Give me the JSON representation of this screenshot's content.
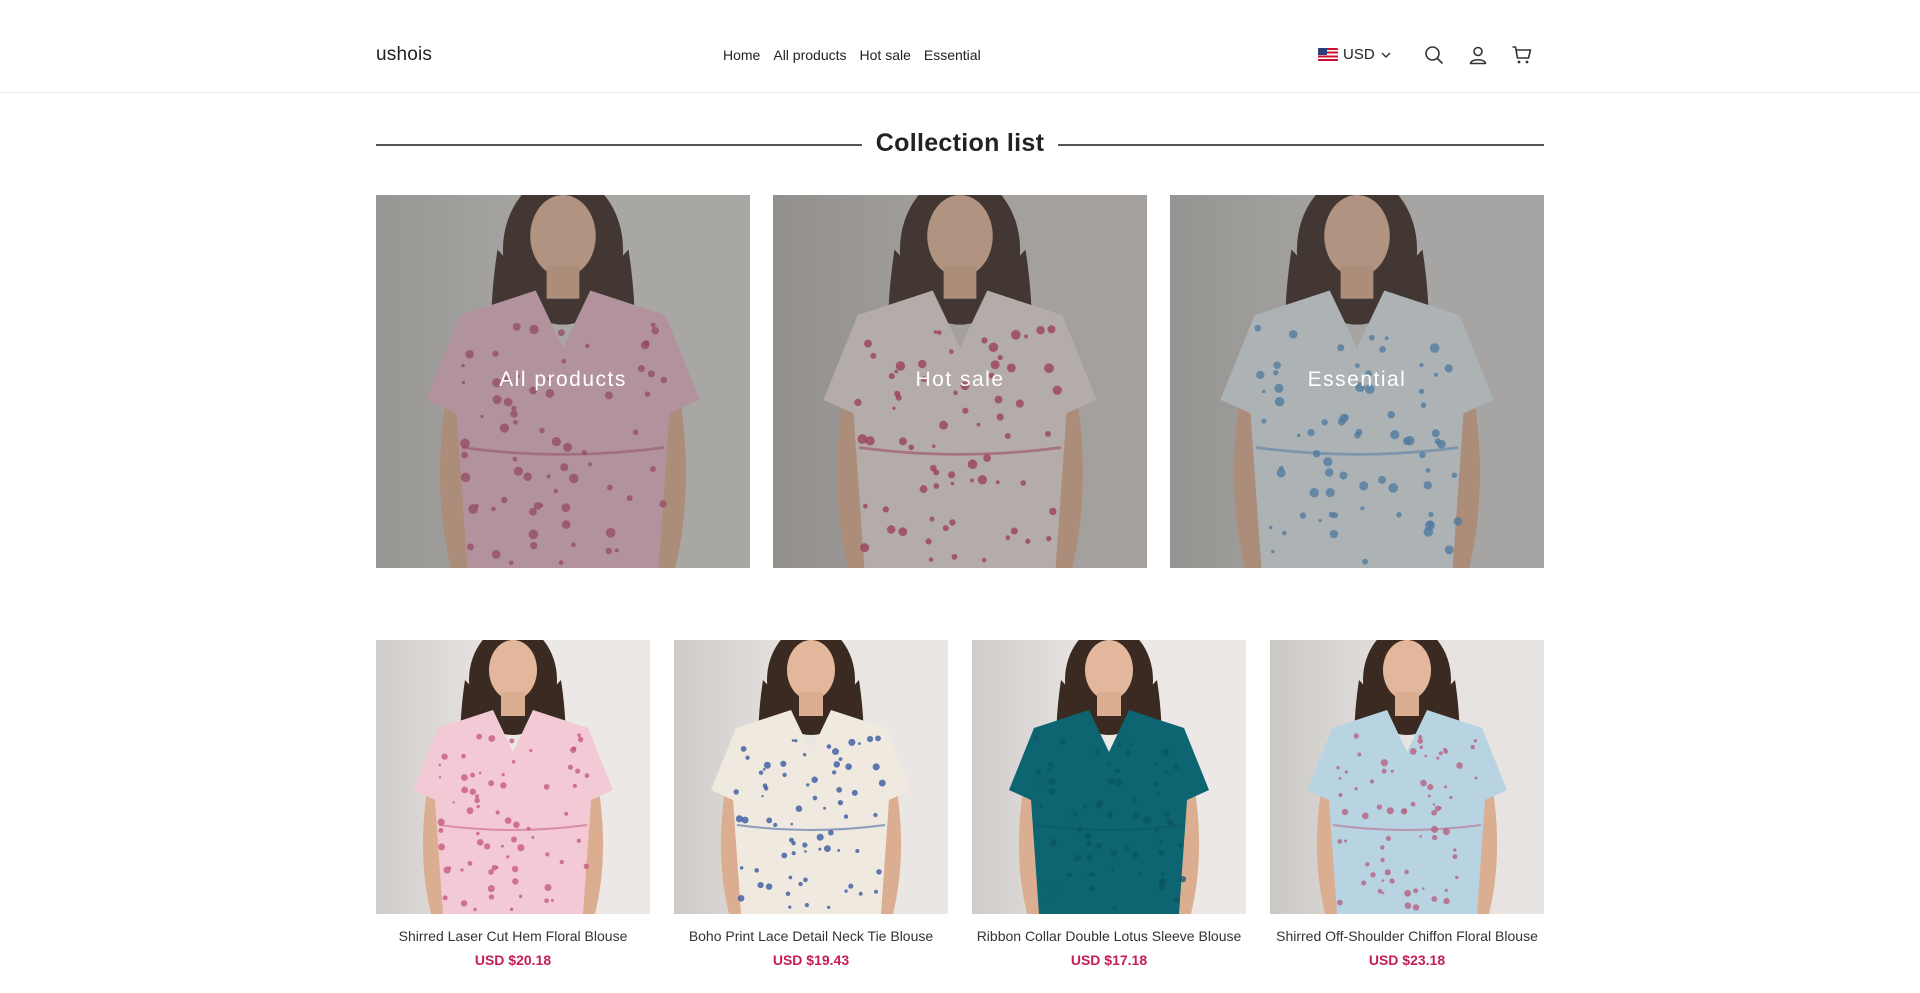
{
  "header": {
    "logo": "ushois",
    "nav": [
      "Home",
      "All products",
      "Hot sale",
      "Essential"
    ],
    "currency": "USD",
    "icons": [
      "flag-us-icon",
      "chevron-down-icon",
      "search-icon",
      "account-icon",
      "cart-icon"
    ]
  },
  "collection": {
    "title": "Collection list",
    "cards": [
      {
        "label": "All products",
        "palette": {
          "bg": "#d9d6d2",
          "dress": "#e7b7c6",
          "dot": "#b8456e"
        }
      },
      {
        "label": "Hot sale",
        "palette": {
          "bg": "#cfcbc7",
          "dress": "#e9ddd8",
          "dot": "#c12f5a"
        }
      },
      {
        "label": "Essential",
        "palette": {
          "bg": "#d6d3cf",
          "dress": "#dfe6ec",
          "dot": "#4a8fc9"
        }
      }
    ]
  },
  "products": [
    {
      "name": "Shirred Laser Cut Hem Floral Blouse",
      "price": "USD $20.18",
      "palette": {
        "bg": "#ece8e6",
        "dress": "#f2c9d5",
        "dot": "#c2537b"
      }
    },
    {
      "name": "Boho Print Lace Detail Neck Tie Blouse",
      "price": "USD $19.43",
      "palette": {
        "bg": "#e9e6e3",
        "dress": "#efe9df",
        "dot": "#2c4f9c"
      }
    },
    {
      "name": "Ribbon Collar Double Lotus Sleeve Blouse",
      "price": "USD $17.18",
      "palette": {
        "bg": "#ebe8e6",
        "dress": "#0d6572",
        "dot": "#0b5560"
      }
    },
    {
      "name": "Shirred Off-Shoulder Chiffon Floral Blouse",
      "price": "USD $23.18",
      "palette": {
        "bg": "#e6e3e0",
        "dress": "#b8d4e2",
        "dot": "#b65a79"
      }
    }
  ],
  "colors": {
    "price": "#c41e52",
    "divider": "#555555"
  }
}
